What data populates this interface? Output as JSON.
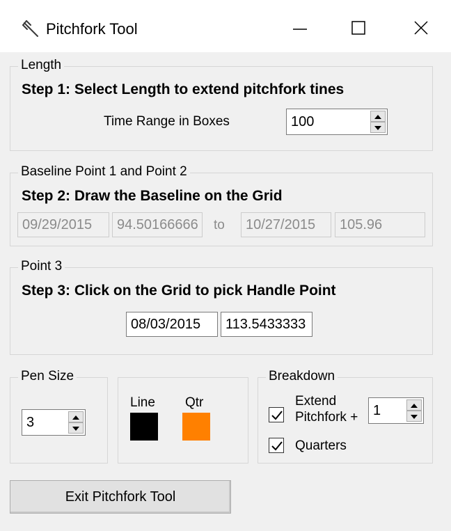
{
  "window": {
    "title": "Pitchfork Tool"
  },
  "length_group": {
    "legend": "Length",
    "step": "Step 1: Select Length to extend pitchfork tines",
    "time_range_label": "Time Range in Boxes",
    "time_range_value": "100"
  },
  "baseline_group": {
    "legend": "Baseline Point 1 and Point 2",
    "step": "Step 2: Draw the Baseline on the Grid",
    "point1_date": "09/29/2015",
    "point1_price": "94.50166666",
    "to_label": "to",
    "point2_date": "10/27/2015",
    "point2_price": "105.96"
  },
  "point3_group": {
    "legend": "Point 3",
    "step": "Step 3: Click on the Grid to pick Handle Point",
    "date": "08/03/2015",
    "price": "113.5433333"
  },
  "pen_group": {
    "legend": "Pen Size",
    "value": "3"
  },
  "colors_group": {
    "line_label": "Line",
    "line_color": "#000000",
    "qtr_label": "Qtr",
    "qtr_color": "#ff8000"
  },
  "breakdown_group": {
    "legend": "Breakdown",
    "extend_label_line1": "Extend",
    "extend_label_line2": "Pitchfork +",
    "extend_checked": true,
    "extend_value": "1",
    "quarters_label": "Quarters",
    "quarters_checked": true
  },
  "exit_button": {
    "label": "Exit Pitchfork Tool"
  }
}
